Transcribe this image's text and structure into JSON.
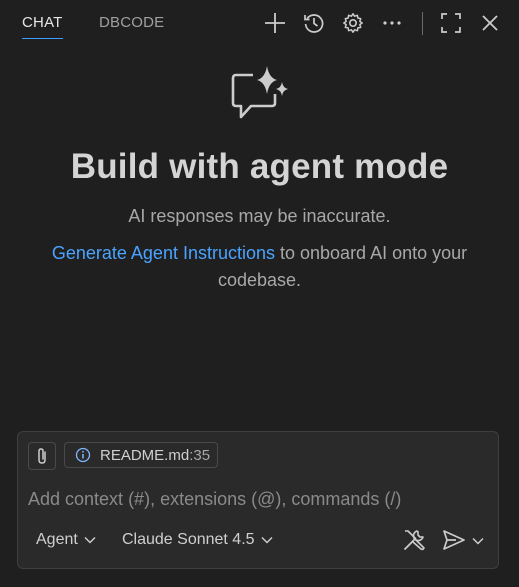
{
  "tabs": [
    {
      "label": "CHAT",
      "active": true
    },
    {
      "label": "DBCODE",
      "active": false
    }
  ],
  "header_icons": [
    "add-icon",
    "history-icon",
    "gear-icon",
    "more-icon",
    "maximize-icon",
    "close-icon"
  ],
  "hero": {
    "icon": "chat-sparkle-icon",
    "title": "Build with agent mode",
    "subtitle": "AI responses may be inaccurate.",
    "link_text": "Generate Agent Instructions",
    "desc_rest": " to onboard AI onto your codebase."
  },
  "input": {
    "attach_icon": "paperclip-icon",
    "context_file": {
      "name": "README.md",
      "line": ":35",
      "icon": "info-icon"
    },
    "placeholder": "Add context (#), extensions (@), commands (/)",
    "mode_label": "Agent",
    "model_label": "Claude Sonnet 4.5",
    "tools_icon": "tools-icon",
    "send_icon": "send-icon"
  },
  "colors": {
    "background": "#1f1f1f",
    "panel": "#2a2a2a",
    "link": "#4aa3ff",
    "active_tab_underline": "#3f9cff"
  }
}
